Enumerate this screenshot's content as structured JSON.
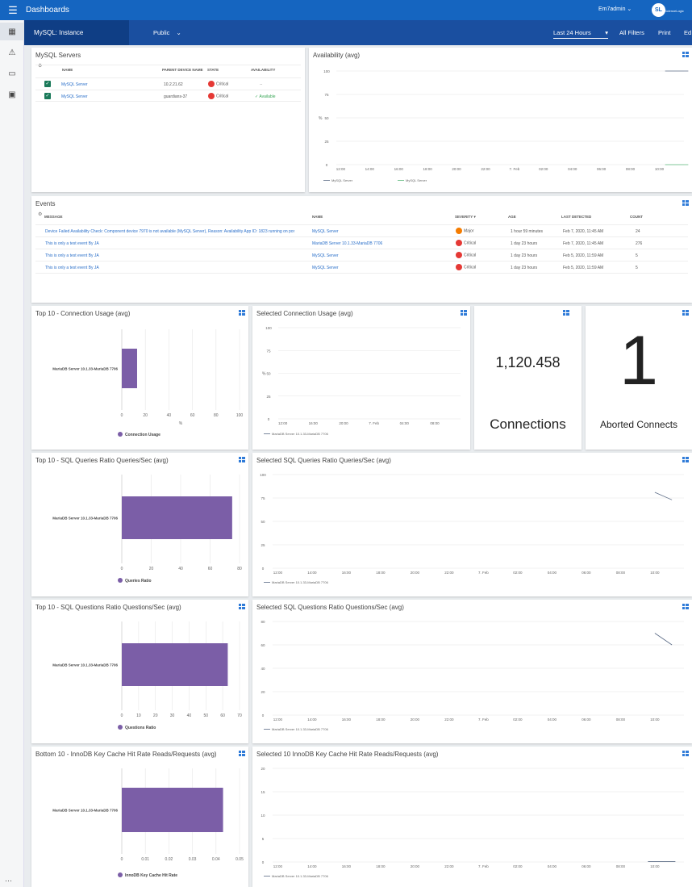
{
  "topbar": {
    "title": "Dashboards",
    "user": "Em7admin",
    "logo_text": "ScienceLogic"
  },
  "subbar": {
    "instance": "MySQL: Instance",
    "visibility": "Public",
    "time_range": "Last 24 Hours",
    "all_filters": "All Filters",
    "print": "Print",
    "edit": "Ed"
  },
  "servers": {
    "title": "MySQL Servers",
    "headers": {
      "name": "NAME",
      "parent": "PARENT DEVICE NAME",
      "state": "STATE",
      "availability": "AVAILABILITY"
    },
    "rows": [
      {
        "name": "MySQL Server",
        "parent": "10.2.21.62",
        "state": "Critical",
        "availability": "--"
      },
      {
        "name": "MySQL Server",
        "parent": "guardians-37",
        "state": "Critical",
        "availability": "Available"
      }
    ]
  },
  "events": {
    "title": "Events",
    "headers": {
      "message": "MESSAGE",
      "name": "NAME",
      "severity": "SEVERITY",
      "age": "AGE",
      "last": "LAST DETECTED",
      "count": "COUNT"
    },
    "rows": [
      {
        "message": "Device Failed Availability Check: Component device 7970 is not available (MySQL Server), Reason: Availability App ID: 1823 running on por",
        "name": "MySQL Server",
        "severity": "Major",
        "color": "#f57c00",
        "age": "1 hour 59 minutes",
        "last": "Feb 7, 2020, 11:45 AM",
        "count": "24"
      },
      {
        "message": "This is only a test event By JA",
        "name": "MariaDB Server 10.1.33-MariaDB 7706",
        "severity": "Critical",
        "color": "#e53935",
        "age": "1 day 23 hours",
        "last": "Feb 7, 2020, 11:45 AM",
        "count": "276"
      },
      {
        "message": "This is only a test event By JA",
        "name": "MySQL Server",
        "severity": "Critical",
        "color": "#e53935",
        "age": "1 day 23 hours",
        "last": "Feb 5, 2020, 11:59 AM",
        "count": "5"
      },
      {
        "message": "This is only a test event By JA",
        "name": "MySQL Server",
        "severity": "Critical",
        "color": "#e53935",
        "age": "1 day 23 hours",
        "last": "Feb 5, 2020, 11:59 AM",
        "count": "5"
      }
    ]
  },
  "widgets": {
    "availability": "Availability (avg)",
    "top_conn": "Top 10 - Connection Usage (avg)",
    "sel_conn": "Selected Connection Usage (avg)",
    "top_queries": "Top 10 - SQL Queries Ratio Queries/Sec (avg)",
    "sel_queries": "Selected SQL Queries Ratio Queries/Sec (avg)",
    "top_questions": "Top 10 - SQL Questions Ratio Questions/Sec (avg)",
    "sel_questions": "Selected SQL Questions Ratio Questions/Sec (avg)",
    "bottom_cache": "Bottom 10 - InnoDB Key Cache Hit Rate Reads/Requests (avg)",
    "sel_cache": "Selected 10 InnoDB Key Cache Hit Rate Reads/Requests (avg)"
  },
  "kpi": {
    "connections_value": "1,120.458",
    "connections_label": "Connections",
    "aborted_value": "1",
    "aborted_label": "Aborted Connects"
  },
  "colors": {
    "bar": "#7b5ea7",
    "line": "#5a6a85",
    "accent": "#1565c0"
  },
  "chart_data": [
    {
      "id": "availability",
      "type": "line",
      "x_ticks": [
        "12:00",
        "14:00",
        "16:00",
        "18:00",
        "20:00",
        "22:00",
        "7. Feb",
        "02:00",
        "04:00",
        "06:00",
        "08:00",
        "10:00"
      ],
      "ylabel": "%",
      "ylim": [
        0,
        100
      ],
      "y_ticks": [
        0,
        25,
        50,
        75,
        100
      ],
      "series": [
        {
          "name": "MySQL Server",
          "points": [
            [
              11.2,
              100
            ],
            [
              12,
              100
            ]
          ]
        },
        {
          "name": "MySQL Server",
          "points": [
            [
              11.2,
              0
            ],
            [
              12,
              0
            ]
          ]
        }
      ]
    },
    {
      "id": "top_conn",
      "type": "bar",
      "orientation": "horizontal",
      "categories": [
        "MariaDB Server 10.1.33-MariaDB 7706"
      ],
      "values": [
        13
      ],
      "xlim": [
        0,
        100
      ],
      "x_ticks": [
        0,
        20,
        40,
        60,
        80,
        100
      ],
      "xlabel": "%",
      "series_name": "Connection Usage"
    },
    {
      "id": "sel_conn",
      "type": "line",
      "x_ticks": [
        "12:00",
        "16:00",
        "20:00",
        "7. Feb",
        "04:00",
        "08:00"
      ],
      "ylabel": "%",
      "ylim": [
        0,
        100
      ],
      "y_ticks": [
        0,
        25,
        50,
        75,
        100
      ],
      "series": [
        {
          "name": "MariaDB Server 10.1.33-MariaDB 7706",
          "points": [
            [
              9.95,
              13
            ],
            [
              10.5,
              14
            ],
            [
              11,
              14
            ]
          ]
        }
      ]
    },
    {
      "id": "top_queries",
      "type": "bar",
      "orientation": "horizontal",
      "categories": [
        "MariaDB Server 10.1.33-MariaDB 7706"
      ],
      "values": [
        75
      ],
      "xlim": [
        0,
        80
      ],
      "x_ticks": [
        0,
        20,
        40,
        60,
        80
      ],
      "series_name": "Queries Ratio"
    },
    {
      "id": "sel_queries",
      "type": "line",
      "x_ticks": [
        "12:00",
        "14:00",
        "16:00",
        "18:00",
        "20:00",
        "22:00",
        "7. Feb",
        "02:00",
        "04:00",
        "06:00",
        "08:00",
        "10:00"
      ],
      "ylim": [
        0,
        100
      ],
      "y_ticks": [
        0,
        25,
        50,
        75,
        100
      ],
      "series": [
        {
          "name": "MariaDB Server 10.1.33-MariaDB 7706",
          "points": [
            [
              11,
              81
            ],
            [
              11.5,
              73
            ]
          ]
        }
      ]
    },
    {
      "id": "top_questions",
      "type": "bar",
      "orientation": "horizontal",
      "categories": [
        "MariaDB Server 10.1.33-MariaDB 7706"
      ],
      "values": [
        63
      ],
      "xlim": [
        0,
        70
      ],
      "x_ticks": [
        0,
        10,
        20,
        30,
        40,
        50,
        60,
        70
      ],
      "series_name": "Questions Ratio"
    },
    {
      "id": "sel_questions",
      "type": "line",
      "x_ticks": [
        "12:00",
        "14:00",
        "16:00",
        "18:00",
        "20:00",
        "22:00",
        "7. Feb",
        "02:00",
        "04:00",
        "06:00",
        "08:00",
        "10:00"
      ],
      "ylim": [
        0,
        80
      ],
      "y_ticks": [
        0,
        20,
        40,
        60,
        80
      ],
      "series": [
        {
          "name": "MariaDB Server 10.1.33-MariaDB 7706",
          "points": [
            [
              11,
              70
            ],
            [
              11.5,
              60
            ]
          ]
        }
      ]
    },
    {
      "id": "bottom_cache",
      "type": "bar",
      "orientation": "horizontal",
      "categories": [
        "MariaDB Server 10.1.33-MariaDB 7706"
      ],
      "values": [
        0.043
      ],
      "xlim": [
        0,
        0.05
      ],
      "x_ticks": [
        "0",
        "0.01",
        "0.02",
        "0.03",
        "0.04",
        "0.05"
      ],
      "series_name": "InnoDB Key Cache Hit Rate"
    },
    {
      "id": "sel_cache",
      "type": "line",
      "x_ticks": [
        "12:00",
        "14:00",
        "16:00",
        "18:00",
        "20:00",
        "22:00",
        "7. Feb",
        "02:00",
        "04:00",
        "06:00",
        "08:00",
        "10:00"
      ],
      "ylim": [
        0,
        20
      ],
      "y_ticks": [
        0,
        5,
        10,
        15,
        20
      ],
      "series": [
        {
          "name": "MariaDB Server 10.1.33-MariaDB 7706",
          "points": [
            [
              10.8,
              0.1
            ],
            [
              11.6,
              0.1
            ]
          ]
        }
      ]
    }
  ]
}
